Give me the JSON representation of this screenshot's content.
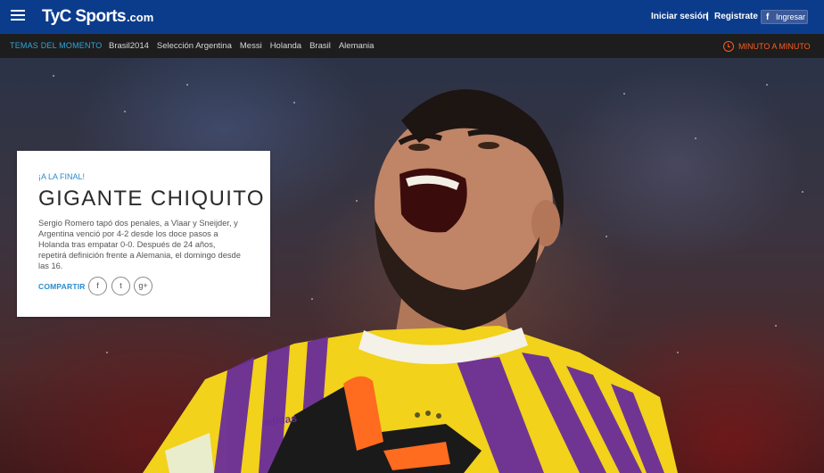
{
  "header": {
    "logo_text": "TyC Sports",
    "logo_domain": ".com",
    "login_label": "Iniciar sesión",
    "separator": "|",
    "register_label": "Registrate",
    "facebook_button_label": "Ingresar",
    "background_color": "#0b3c8c"
  },
  "nav": {
    "section_label": "TEMAS DEL MOMENTO",
    "items": [
      "Brasil2014",
      "Selección Argentina",
      "Messi",
      "Holanda",
      "Brasil",
      "Alemania"
    ],
    "minuto_label": "MINUTO A MINUTO",
    "accent_color": "#ff5a1f"
  },
  "article": {
    "kicker": "¡A LA FINAL!",
    "headline": "GIGANTE CHIQUITO",
    "summary": "Sergio Romero tapó dos penales, a Vlaar y Sneijder, y Argentina venció por 4-2 desde los doce pasos a Holanda tras empatar 0-0. Después de 24 años, repetirá definición frente a Alemania, el domingo desde las 16.",
    "share_label": "COMPARTIR",
    "share_buttons": [
      {
        "icon": "facebook-icon",
        "glyph": "f"
      },
      {
        "icon": "twitter-icon",
        "glyph": "t"
      },
      {
        "icon": "google-plus-icon",
        "glyph": "g+"
      }
    ]
  },
  "hero": {
    "jersey_brand": "adidas",
    "jersey_primary": "#f2d21a",
    "jersey_stripes": "#6a2d9a"
  }
}
